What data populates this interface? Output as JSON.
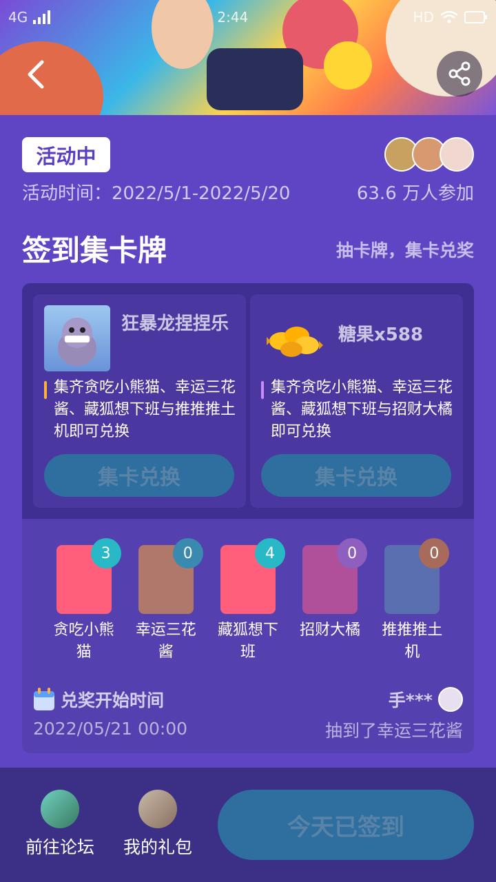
{
  "status_bar": {
    "network": "4G",
    "time": "2:44",
    "hd": "HD"
  },
  "header": {
    "back_icon": "chevron-left-icon",
    "share_icon": "share-icon"
  },
  "activity": {
    "status": "活动中",
    "time_text": "活动时间：2022/5/1-2022/5/20",
    "participants": "63.6 万人参加"
  },
  "section": {
    "title": "签到集卡牌",
    "subtitle": "抽卡牌，集卡兑奖"
  },
  "rewards": [
    {
      "name": "狂暴龙捏捏乐",
      "desc": "集齐贪吃小熊猫、幸运三花酱、藏狐想下班与推推推土机即可兑换",
      "button": "集卡兑换"
    },
    {
      "name": "糖果x588",
      "desc": "集齐贪吃小熊猫、幸运三花酱、藏狐想下班与招财大橘即可兑换",
      "button": "集卡兑换"
    }
  ],
  "cards": [
    {
      "name": "贪吃小熊猫",
      "count": "3",
      "badge_color": "#28b8c6",
      "bg": "#ff5f7a"
    },
    {
      "name": "幸运三花酱",
      "count": "0",
      "badge_color": "#3a8ab0",
      "bg": "#b0786a"
    },
    {
      "name": "藏狐想下班",
      "count": "4",
      "badge_color": "#28b8c6",
      "bg": "#ff5f7a"
    },
    {
      "name": "招财大橘",
      "count": "0",
      "badge_color": "#8f5fbf",
      "bg": "#b04f9a"
    },
    {
      "name": "推推推土机",
      "count": "0",
      "badge_color": "#a86a5a",
      "bg": "#5a6fb0"
    }
  ],
  "redeem": {
    "label": "兑奖开始时间",
    "date": "2022/05/21 00:00"
  },
  "broadcast": {
    "user": "手***",
    "message": "抽到了幸运三花酱"
  },
  "bottom": {
    "forum": "前往论坛",
    "gift": "我的礼包",
    "signed": "今天已签到"
  }
}
